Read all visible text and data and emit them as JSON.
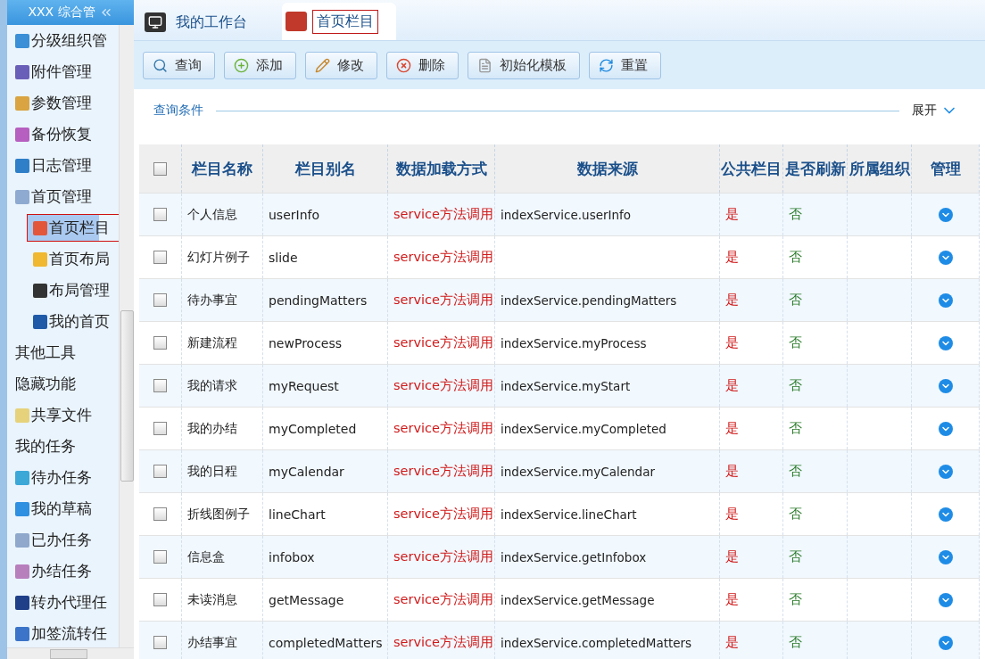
{
  "sidebar": {
    "title": "XXX 综合管",
    "items": [
      {
        "label": "分级组织管",
        "kind": "icon",
        "color": "#3a8fd6",
        "selected": false,
        "marked": false
      },
      {
        "label": "附件管理",
        "kind": "icon",
        "color": "#6a5fb8",
        "selected": false,
        "marked": false
      },
      {
        "label": "参数管理",
        "kind": "icon",
        "color": "#d9a441",
        "selected": false,
        "marked": false
      },
      {
        "label": "备份恢复",
        "kind": "icon",
        "color": "#b65fc0",
        "selected": false,
        "marked": false
      },
      {
        "label": "日志管理",
        "kind": "icon",
        "color": "#2f7fc8",
        "selected": false,
        "marked": false
      },
      {
        "label": "首页管理",
        "kind": "icon",
        "color": "#8faad0",
        "selected": false,
        "marked": false,
        "children": [
          {
            "label": "首页栏目",
            "kind": "icon",
            "color": "#e2563c",
            "selected": true,
            "marked": true
          },
          {
            "label": "首页布局",
            "kind": "icon",
            "color": "#f0b730",
            "selected": false,
            "marked": false
          },
          {
            "label": "布局管理",
            "kind": "icon",
            "color": "#333333",
            "selected": false,
            "marked": false
          },
          {
            "label": "我的首页",
            "kind": "icon",
            "color": "#1f5aa8",
            "selected": false,
            "marked": false
          }
        ]
      },
      {
        "label": "其他工具",
        "kind": "text",
        "selected": false,
        "marked": false
      },
      {
        "label": "隐藏功能",
        "kind": "text",
        "selected": false,
        "marked": false
      },
      {
        "label": "共享文件",
        "kind": "icon",
        "color": "#e6d27a",
        "selected": false,
        "marked": false
      },
      {
        "label": "我的任务",
        "kind": "text",
        "selected": false,
        "marked": false
      },
      {
        "label": "待办任务",
        "kind": "icon",
        "color": "#3ba8d8",
        "selected": false,
        "marked": false
      },
      {
        "label": "我的草稿",
        "kind": "icon",
        "color": "#2f8fe0",
        "selected": false,
        "marked": false
      },
      {
        "label": "已办任务",
        "kind": "icon",
        "color": "#8fa8cc",
        "selected": false,
        "marked": false
      },
      {
        "label": "办结任务",
        "kind": "icon",
        "color": "#b87fbd",
        "selected": false,
        "marked": false
      },
      {
        "label": "转办代理任",
        "kind": "icon",
        "color": "#1f3f88",
        "selected": false,
        "marked": false
      },
      {
        "label": "加签流转任",
        "kind": "icon",
        "color": "#3b74c8",
        "selected": false,
        "marked": false
      }
    ]
  },
  "tabs": [
    {
      "label": "我的工作台",
      "selected": false,
      "marked": false
    },
    {
      "label": "首页栏目",
      "selected": true,
      "marked": true
    }
  ],
  "toolbar": [
    {
      "label": "查询",
      "kind": "search"
    },
    {
      "label": "添加",
      "kind": "add"
    },
    {
      "label": "修改",
      "kind": "edit"
    },
    {
      "label": "删除",
      "kind": "delete"
    },
    {
      "label": "初始化模板",
      "kind": "file"
    },
    {
      "label": "重置",
      "kind": "refresh"
    }
  ],
  "query": {
    "title": "查询条件",
    "toggle": "展开"
  },
  "table": {
    "select_all": {
      "checked": false
    },
    "columns": [
      "栏目名称",
      "栏目别名",
      "数据加载方式",
      "数据来源",
      "公共栏目",
      "是否刷新",
      "所属组织",
      "管理"
    ],
    "rows": [
      {
        "checked": false,
        "cells": [
          "个人信息",
          "userInfo",
          "service方法调用",
          "indexService.userInfo",
          "是",
          "否",
          ""
        ]
      },
      {
        "checked": false,
        "cells": [
          "幻灯片例子",
          "slide",
          "service方法调用",
          "",
          "是",
          "否",
          ""
        ]
      },
      {
        "checked": false,
        "cells": [
          "待办事宜",
          "pendingMatters",
          "service方法调用",
          "indexService.pendingMatters",
          "是",
          "否",
          ""
        ]
      },
      {
        "checked": false,
        "cells": [
          "新建流程",
          "newProcess",
          "service方法调用",
          "indexService.myProcess",
          "是",
          "否",
          ""
        ]
      },
      {
        "checked": false,
        "cells": [
          "我的请求",
          "myRequest",
          "service方法调用",
          "indexService.myStart",
          "是",
          "否",
          ""
        ]
      },
      {
        "checked": false,
        "cells": [
          "我的办结",
          "myCompleted",
          "service方法调用",
          "indexService.myCompleted",
          "是",
          "否",
          ""
        ]
      },
      {
        "checked": false,
        "cells": [
          "我的日程",
          "myCalendar",
          "service方法调用",
          "indexService.myCalendar",
          "是",
          "否",
          ""
        ]
      },
      {
        "checked": false,
        "cells": [
          "折线图例子",
          "lineChart",
          "service方法调用",
          "indexService.lineChart",
          "是",
          "否",
          ""
        ]
      },
      {
        "checked": false,
        "cells": [
          "信息盒",
          "infobox",
          "service方法调用",
          "indexService.getInfobox",
          "是",
          "否",
          ""
        ]
      },
      {
        "checked": false,
        "cells": [
          "未读消息",
          "getMessage",
          "service方法调用",
          "indexService.getMessage",
          "是",
          "否",
          ""
        ]
      },
      {
        "checked": false,
        "cells": [
          "办结事宜",
          "completedMatters",
          "service方法调用",
          "indexService.completedMatters",
          "是",
          "否",
          ""
        ]
      }
    ]
  }
}
